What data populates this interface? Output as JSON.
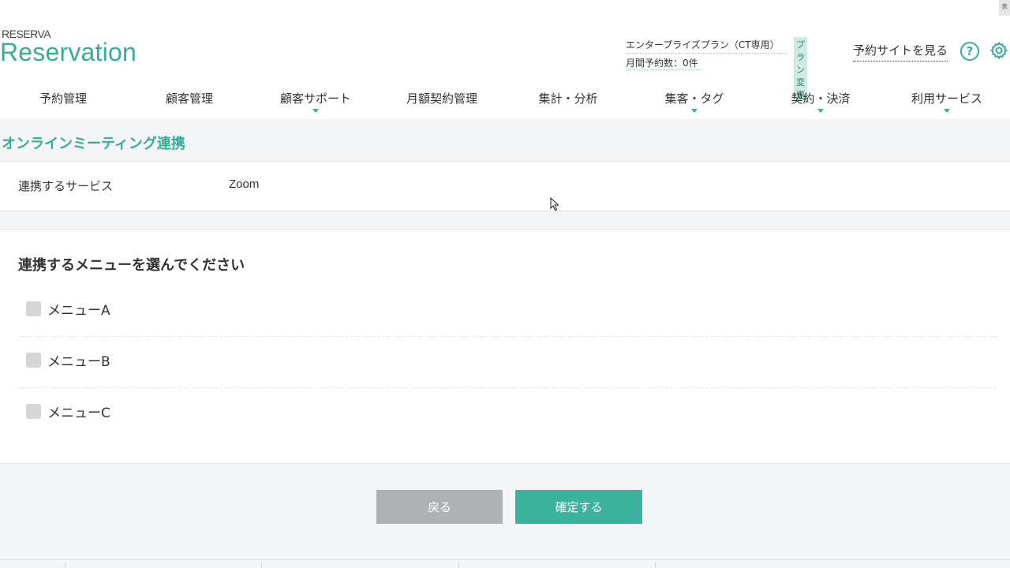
{
  "brand": {
    "small": "RESERVA",
    "big": "Reservation"
  },
  "header": {
    "plan_name": "エンタープライズプラン（CT専用）",
    "plan_change": "プラン変更",
    "monthly_reservations": "月間予約数：0件",
    "view_site": "予約サイトを見る",
    "help_glyph": "?",
    "corner_glyph": "表"
  },
  "nav": [
    {
      "label": "予約管理",
      "has_dropdown": false
    },
    {
      "label": "顧客管理",
      "has_dropdown": false
    },
    {
      "label": "顧客サポート",
      "has_dropdown": true
    },
    {
      "label": "月額契約管理",
      "has_dropdown": false
    },
    {
      "label": "集計・分析",
      "has_dropdown": false
    },
    {
      "label": "集客・タグ",
      "has_dropdown": true
    },
    {
      "label": "契約・決済",
      "has_dropdown": true
    },
    {
      "label": "利用サービス",
      "has_dropdown": true
    }
  ],
  "page": {
    "title": "オンラインミーティング連携",
    "service_label": "連携するサービス",
    "service_value": "Zoom",
    "menu_heading": "連携するメニューを選んでください",
    "menus": [
      {
        "label": "メニューA",
        "checked": false
      },
      {
        "label": "メニューB",
        "checked": false
      },
      {
        "label": "メニューC",
        "checked": false
      }
    ]
  },
  "buttons": {
    "back": "戻る",
    "confirm": "確定する"
  },
  "colors": {
    "accent": "#35ad9a",
    "back_button": "#aeb2b5",
    "confirm_button": "#3cb39e"
  }
}
